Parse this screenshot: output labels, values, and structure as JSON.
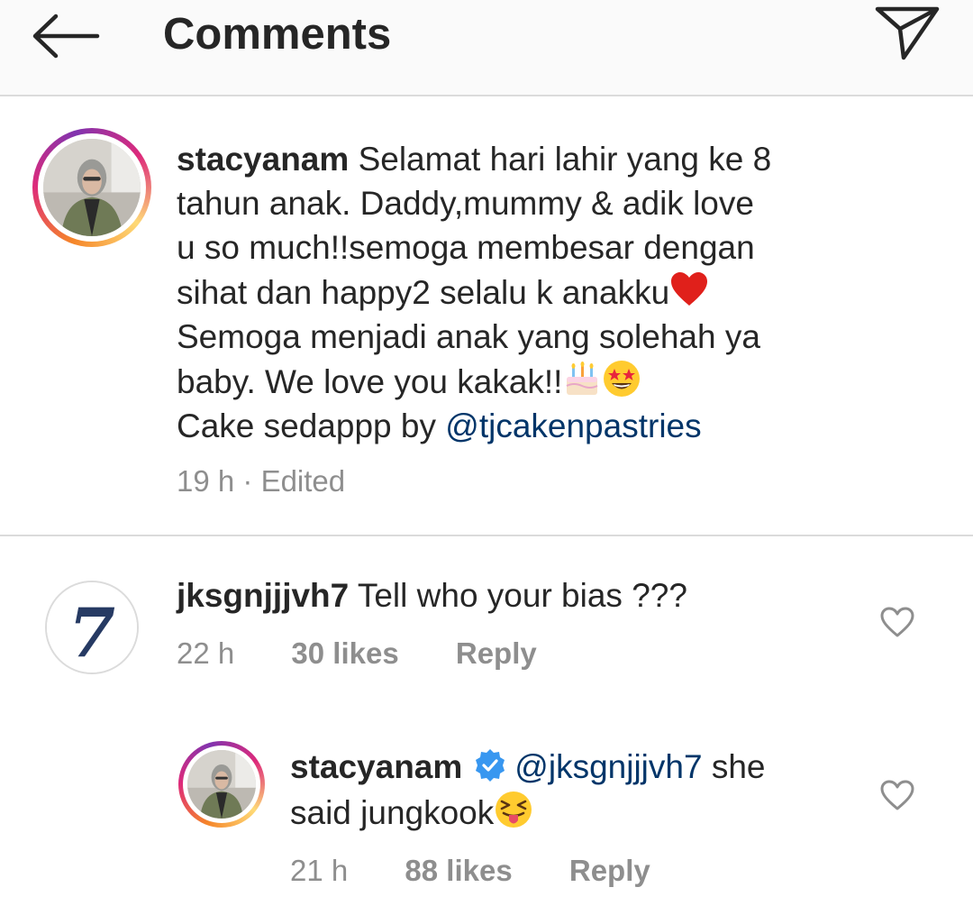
{
  "header": {
    "title": "Comments",
    "back_icon": "arrow-left-icon",
    "send_icon": "paper-plane-icon"
  },
  "caption": {
    "username": "stacyanam",
    "lines": [
      "Selamat hari lahir yang ke 8",
      "tahun anak. Daddy,mummy & adik love",
      "u so much!!semoga membesar dengan",
      "sihat dan happy2 selalu k anakku",
      "Semoga menjadi anak yang solehah ya",
      "baby. We love you kakak!!",
      "Cake sedappp by "
    ],
    "mention": "@tjcakenpastries",
    "emojis": [
      "red-heart",
      "birthday-cake",
      "star-struck-face"
    ],
    "time": "19 h",
    "separator": " · ",
    "edited": "Edited"
  },
  "comments": [
    {
      "username": "jksgnjjjvh7",
      "text": " Tell who your bias ???",
      "time": "22 h",
      "likes": "30 likes",
      "reply": "Reply",
      "avatar_text": "7"
    },
    {
      "username": "stacyanam",
      "verified": true,
      "mention": "@jksgnjjjvh7",
      "text_line1": " she",
      "text_line2": "said jungkook",
      "emoji": "squinting-face-with-tongue",
      "time": "21 h",
      "likes": "88 likes",
      "reply": "Reply"
    }
  ],
  "colors": {
    "text": "#262626",
    "secondary": "#8e8e8e",
    "mention": "#003569",
    "verified": "#3897f0",
    "divider": "#dbdbdb",
    "header_bg": "#fafafa"
  }
}
